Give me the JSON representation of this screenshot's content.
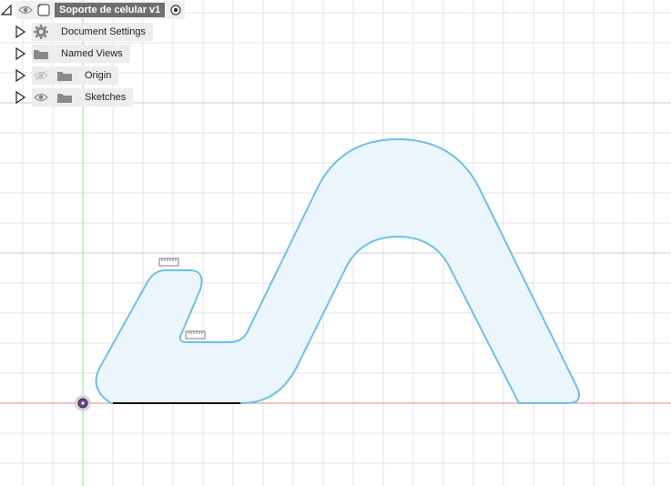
{
  "browser": {
    "root": {
      "title": "Soporte de celular v1"
    },
    "items": [
      {
        "label": "Document Settings",
        "icon": "gear-icon"
      },
      {
        "label": "Named Views",
        "icon": "folder-icon"
      },
      {
        "label": "Origin",
        "icon": "folder-icon",
        "visibility": "hidden"
      },
      {
        "label": "Sketches",
        "icon": "folder-icon",
        "visibility": "visible"
      }
    ]
  },
  "colors": {
    "profile_stroke": "#6ec1e4",
    "profile_fill": "#eaf5fc",
    "x_axis": "#f08080",
    "y_axis": "#90e090",
    "grid": "#e3e3e3",
    "grid_major": "#cfcfcf"
  }
}
